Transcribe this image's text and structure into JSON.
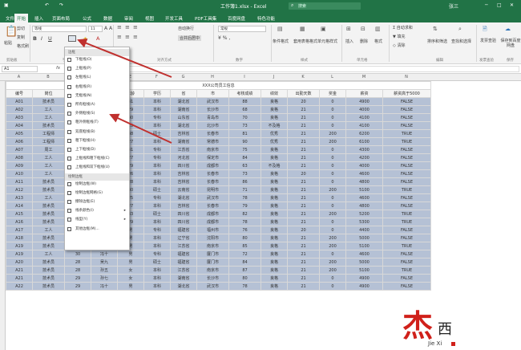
{
  "colors": {
    "title_bar": "#217346",
    "data_fill": "#b5c1d5",
    "arrow": "#c0302e",
    "logo_red": "#d0201a"
  },
  "title_bar": {
    "filename": "工作簿1.xlsx - Excel",
    "search_placeholder": "搜索",
    "user": "张三"
  },
  "tabs": [
    "文件",
    "开始",
    "插入",
    "页面布局",
    "公式",
    "数据",
    "审阅",
    "视图",
    "开发工具",
    "PDF工具集",
    "百度网盘",
    "特色功能"
  ],
  "active_tab": "开始",
  "ribbon": {
    "paste": "粘贴",
    "cut": "剪切",
    "copy": "复制",
    "format_painter": "格式刷",
    "clipboard_group": "剪贴板",
    "font_name": "等线",
    "font_size": "11",
    "font_group": "字体",
    "wrap_text": "自动换行",
    "merge_center": "合并后居中",
    "align_group": "对齐方式",
    "number_format": "常规",
    "number_group": "数字",
    "conditional_format": "条件格式",
    "table_format": "套用表格格式",
    "cell_styles": "单元格样式",
    "styles_group": "样式",
    "insert": "插入",
    "delete": "删除",
    "format": "格式",
    "cells_group": "单元格",
    "autosum": "自动求和",
    "fill": "填充",
    "clear": "清除",
    "sort_filter": "排序和筛选",
    "find_select": "查找和选择",
    "editing_group": "编辑",
    "invoice_verify": "发票查验",
    "invoice_group": "发票查验",
    "save_baidu": "保存到百度网盘",
    "save_group": "保存"
  },
  "formula_bar": {
    "name_box": "A1",
    "fx": "fx"
  },
  "columns": [
    "A",
    "B",
    "C",
    "D",
    "E",
    "F",
    "G",
    "H",
    "I",
    "J",
    "K",
    "L",
    "M",
    "N",
    "O"
  ],
  "sheet": {
    "title": "XXX公司员工信息",
    "headers": [
      "编号",
      "岗位",
      "姓名",
      "性别",
      "年龄",
      "学历",
      "省",
      "市",
      "考核成绩",
      "绩效",
      "出勤天数",
      "奖金",
      "薪资",
      "薪资高于5000"
    ],
    "rows": [
      [
        "A01",
        "技术员",
        "",
        "男",
        "31",
        "本科",
        "湖北省",
        "武汉市",
        "88",
        "良格",
        "20",
        "0",
        "4900",
        "FALSE"
      ],
      [
        "A02",
        "工人",
        "",
        "女",
        "29",
        "本科",
        "湖南省",
        "长沙市",
        "68",
        "良格",
        "21",
        "0",
        "4000",
        "FALSE"
      ],
      [
        "A03",
        "工人",
        "",
        "男",
        "30",
        "专科",
        "山东省",
        "青岛市",
        "70",
        "良格",
        "21",
        "0",
        "4100",
        "FALSE"
      ],
      [
        "A04",
        "技术员",
        "",
        "男",
        "29",
        "本科",
        "湖北省",
        "北沙市",
        "73",
        "不及格",
        "21",
        "0",
        "4100",
        "FALSE"
      ],
      [
        "A05",
        "工程师",
        "",
        "女",
        "38",
        "硕士",
        "吉林省",
        "长春市",
        "81",
        "优秀",
        "21",
        "200",
        "6200",
        "TRUE"
      ],
      [
        "A06",
        "工程师",
        "",
        "男",
        "27",
        "本科",
        "湖南省",
        "常德市",
        "90",
        "优秀",
        "21",
        "200",
        "6100",
        "TRUE"
      ],
      [
        "A07",
        "周工",
        "",
        "女",
        "31",
        "专科",
        "江苏省",
        "南京市",
        "75",
        "良格",
        "21",
        "0",
        "4300",
        "FALSE"
      ],
      [
        "A08",
        "工人",
        "",
        "男",
        "27",
        "专科",
        "河北省",
        "保定市",
        "84",
        "良格",
        "21",
        "0",
        "4200",
        "FALSE"
      ],
      [
        "A09",
        "工人",
        "",
        "男",
        "29",
        "本科",
        "四川省",
        "成都市",
        "63",
        "不及格",
        "21",
        "0",
        "4000",
        "FALSE"
      ],
      [
        "A10",
        "工人",
        "",
        "女",
        "26",
        "本科",
        "吉林省",
        "长春市",
        "73",
        "良格",
        "20",
        "0",
        "4600",
        "FALSE"
      ],
      [
        "A11",
        "技术员",
        "",
        "男",
        "28",
        "本科",
        "吉林省",
        "长春市",
        "86",
        "良格",
        "21",
        "0",
        "4800",
        "FALSE"
      ],
      [
        "A12",
        "技术员",
        "",
        "女",
        "30",
        "硕士",
        "云南省",
        "昆明市",
        "71",
        "良格",
        "21",
        "200",
        "5100",
        "TRUE"
      ],
      [
        "A13",
        "工人",
        "",
        "男",
        "25",
        "专科",
        "湖北省",
        "武汉市",
        "78",
        "良格",
        "21",
        "0",
        "4600",
        "FALSE"
      ],
      [
        "A14",
        "技术员",
        "",
        "男",
        "27",
        "本科",
        "吉林省",
        "长春市",
        "79",
        "良格",
        "21",
        "0",
        "4800",
        "FALSE"
      ],
      [
        "A15",
        "技术员",
        "",
        "女",
        "33",
        "硕士",
        "四川省",
        "成都市",
        "82",
        "良格",
        "21",
        "200",
        "5200",
        "TRUE"
      ],
      [
        "A16",
        "技术员",
        "杨十四",
        "男",
        "29",
        "本科",
        "四川省",
        "成都市",
        "78",
        "良格",
        "21",
        "0",
        "5300",
        "TRUE"
      ],
      [
        "A17",
        "工人",
        "25",
        "孙C",
        "男",
        "专科",
        "福建省",
        "福州市",
        "76",
        "良格",
        "20",
        "0",
        "4400",
        "FALSE"
      ],
      [
        "A18",
        "技术员",
        "26",
        "李九",
        "男",
        "本科",
        "辽宁省",
        "沈阳市",
        "80",
        "良格",
        "21",
        "200",
        "5000",
        "FALSE"
      ],
      [
        "A19",
        "技术员",
        "27",
        "赵十",
        "男",
        "本科",
        "江苏省",
        "南京市",
        "85",
        "良格",
        "21",
        "200",
        "5100",
        "TRUE"
      ],
      [
        "A19",
        "工人",
        "30",
        "冯十",
        "男",
        "专科",
        "福建省",
        "厦门市",
        "72",
        "良格",
        "21",
        "0",
        "4600",
        "FALSE"
      ],
      [
        "A20",
        "技术员",
        "28",
        "吴九",
        "男",
        "硕士",
        "福建省",
        "厦门市",
        "84",
        "良格",
        "21",
        "200",
        "5000",
        "FALSE"
      ],
      [
        "A21",
        "技术员",
        "28",
        "孙五",
        "女",
        "本科",
        "江苏省",
        "南京市",
        "87",
        "良格",
        "21",
        "200",
        "5100",
        "TRUE"
      ],
      [
        "A21",
        "技术员",
        "29",
        "孙七",
        "女",
        "本科",
        "湖南省",
        "长沙市",
        "80",
        "良格",
        "21",
        "0",
        "4900",
        "FALSE"
      ],
      [
        "A22",
        "技术员",
        "29",
        "冯十",
        "男",
        "本科",
        "湖北省",
        "武汉市",
        "78",
        "良格",
        "21",
        "0",
        "4900",
        "FALSE"
      ]
    ]
  },
  "border_menu": {
    "section_borders": "边框",
    "items": [
      "下框线(O)",
      "上框线(P)",
      "左框线(L)",
      "右框线(R)",
      "无框线(N)",
      "所有框线(A)",
      "外侧框线(S)",
      "粗外侧框线(T)",
      "双底框线(B)",
      "粗下框线(H)",
      "上下框线(D)",
      "上框线和粗下框线(C)",
      "上框线和双下框线(U)"
    ],
    "section_draw": "绘制边框",
    "draw_items": [
      "绘制边框(W)",
      "绘制边框网格(G)",
      "擦除边框(E)",
      "线条颜色(I)",
      "线型(Y)",
      "其他边框(M)..."
    ]
  },
  "watermark": {
    "logo_chars": "杰西",
    "latin": "Jie Xi"
  }
}
